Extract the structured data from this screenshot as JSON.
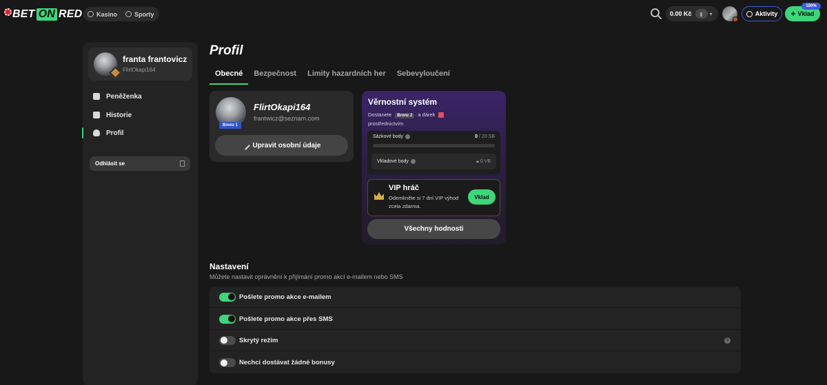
{
  "header": {
    "logo": {
      "part1": "BET",
      "part2": "ON",
      "part3": "RED"
    },
    "nav": [
      {
        "label": "Kasino"
      },
      {
        "label": "Sporty"
      }
    ],
    "balance": "0.00 Kč",
    "aktivity_label": "Aktivity",
    "vklad_label": "Vklad",
    "promo_badge": "100%"
  },
  "sidebar": {
    "user_name": "franta frantovicz",
    "user_handle": "FlirtOkapi164",
    "items": [
      {
        "label": "Peněženka",
        "icon": "wallet-icon"
      },
      {
        "label": "Historie",
        "icon": "history-icon"
      },
      {
        "label": "Profil",
        "icon": "person-icon",
        "active": true
      }
    ],
    "logout_label": "Odhlásit se"
  },
  "main": {
    "title": "Profil",
    "tabs": [
      {
        "label": "Obecné",
        "active": true
      },
      {
        "label": "Bezpečnost"
      },
      {
        "label": "Limity hazardních her"
      },
      {
        "label": "Sebevyloučení"
      }
    ],
    "profile": {
      "nickname": "FlirtOkapi164",
      "email": "frantwicz@seznam.com",
      "badge": "Bronz 1",
      "edit_label": "Upravit osobní údaje"
    },
    "loyalty": {
      "title": "Věrnostní systém",
      "desc_before": "Dostanete",
      "tier": "Bronz 2",
      "desc_after": "a dárek",
      "desc_line2": "prostřednictvím",
      "bet_points_label": "Sázkové body",
      "bet_points_value": "0",
      "bet_points_total": "/ 20 SB",
      "bet_points_progress": 0,
      "deposit_points_label": "Vkladové body",
      "deposit_points_value": "0 VB",
      "vip_title": "VIP hráč",
      "vip_desc": "Odemkněte si 7 dní VIP výhod zcela zdarma.",
      "vip_button": "Vklad",
      "all_button": "Všechny hodnosti"
    },
    "settings": {
      "title": "Nastavení",
      "subtitle": "Můžete nastavit oprávnění k přijímání promo akcí e-mailem nebo SMS",
      "rows": [
        {
          "label": "Pošlete promo akce e-mailem",
          "on": true
        },
        {
          "label": "Pošlete promo akce přes SMS",
          "on": true
        },
        {
          "label": "Skrytý režim",
          "on": false,
          "help": "?"
        },
        {
          "label": "Nechci dostávat žádné bonusy",
          "on": false
        }
      ]
    }
  },
  "colors": {
    "accent": "#3dd67a",
    "blue": "#3f5bd7",
    "bg": "#181818",
    "panel": "#232323"
  }
}
